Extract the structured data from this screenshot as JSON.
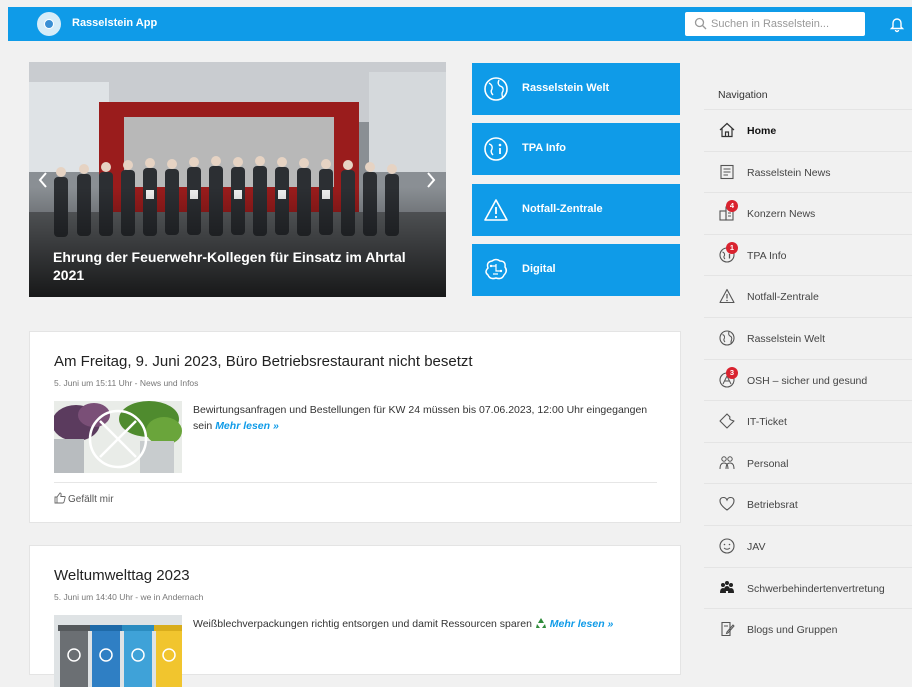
{
  "header": {
    "app_title": "Rasselstein App",
    "search_placeholder": "Suchen in Rasselstein...",
    "brand_color": "#0f9be8"
  },
  "hero": {
    "caption": "Ehrung der Feuerwehr-Kollegen für Einsatz im Ahrtal 2021"
  },
  "tiles": [
    {
      "label": "Rasselstein Welt",
      "icon": "globe-icon"
    },
    {
      "label": "TPA Info",
      "icon": "globe-info-icon"
    },
    {
      "label": "Notfall-Zentrale",
      "icon": "warning-icon"
    },
    {
      "label": "Digital",
      "icon": "brain-circuit-icon"
    }
  ],
  "posts": [
    {
      "title": "Am Freitag, 9. Juni 2023, Büro Betriebsrestaurant nicht besetzt",
      "meta": "5. Juni um 15:11 Uhr - News und Infos",
      "text": "Bewirtungsanfragen und Bestellungen für KW 24 müssen bis 07.06.2023, 12:00 Uhr eingegangen sein",
      "more": "Mehr lesen »",
      "like": "Gefällt mir"
    },
    {
      "title": "Weltumwelttag 2023",
      "meta": "5. Juni um 14:40 Uhr - we in Andernach",
      "text": "Weißblechverpackungen richtig entsorgen und damit Ressourcen sparen",
      "more": "Mehr lesen »"
    }
  ],
  "navigation": {
    "heading": "Navigation",
    "items": [
      {
        "label": "Home",
        "icon": "home-icon",
        "active": true
      },
      {
        "label": "Rasselstein News",
        "icon": "newspaper-icon"
      },
      {
        "label": "Konzern News",
        "icon": "buildings-icon",
        "badge": "4"
      },
      {
        "label": "TPA Info",
        "icon": "globe-info-icon",
        "badge": "1"
      },
      {
        "label": "Notfall-Zentrale",
        "icon": "warning-icon"
      },
      {
        "label": "Rasselstein Welt",
        "icon": "globe-icon"
      },
      {
        "label": "OSH – sicher und gesund",
        "icon": "safety-icon",
        "badge": "3"
      },
      {
        "label": "IT-Ticket",
        "icon": "ticket-icon"
      },
      {
        "label": "Personal",
        "icon": "people-icon"
      },
      {
        "label": "Betriebsrat",
        "icon": "heart-icon"
      },
      {
        "label": "JAV",
        "icon": "smiley-icon"
      },
      {
        "label": "Schwerbehindertenvertretung",
        "icon": "group-icon"
      },
      {
        "label": "Blogs und Gruppen",
        "icon": "blog-icon"
      }
    ]
  }
}
